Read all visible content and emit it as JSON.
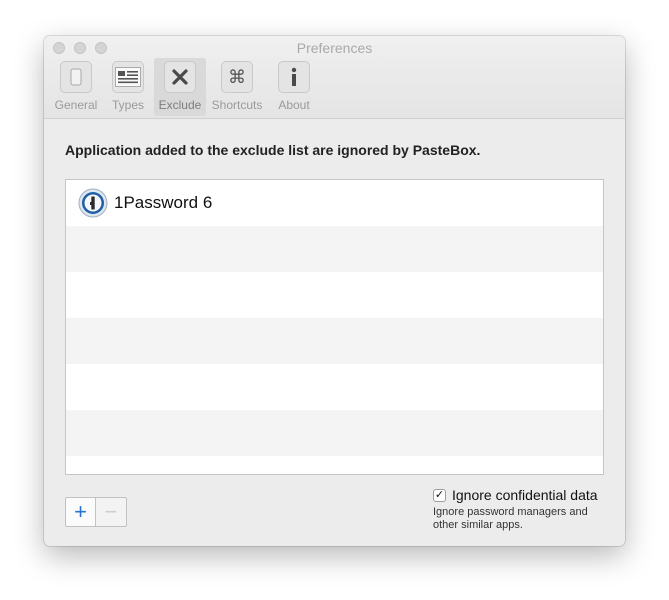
{
  "window": {
    "title": "Preferences"
  },
  "toolbar": {
    "items": [
      {
        "label": "General",
        "icon": "phone-icon"
      },
      {
        "label": "Types",
        "icon": "list-icon"
      },
      {
        "label": "Exclude",
        "icon": "x-icon",
        "selected": true
      },
      {
        "label": "Shortcuts",
        "icon": "command-key-icon"
      },
      {
        "label": "About",
        "icon": "info-icon"
      }
    ]
  },
  "exclude": {
    "headline": "Application added to the exclude list are ignored by PasteBox.",
    "apps": [
      {
        "name": "1Password 6",
        "icon": "1password-icon"
      }
    ],
    "add_label": "+",
    "remove_label": "−",
    "option_label": "Ignore confidential data",
    "option_checked": true,
    "check_mark": "✓",
    "option_help": "Ignore password managers and other similar apps."
  },
  "icons": {
    "command_glyph": "⌘",
    "close_glyph": "✕",
    "info_glyph": "i"
  },
  "colors": {
    "window_bg": "#ececec",
    "accent": "#2a72d0",
    "title_text": "#a9a9a9"
  }
}
